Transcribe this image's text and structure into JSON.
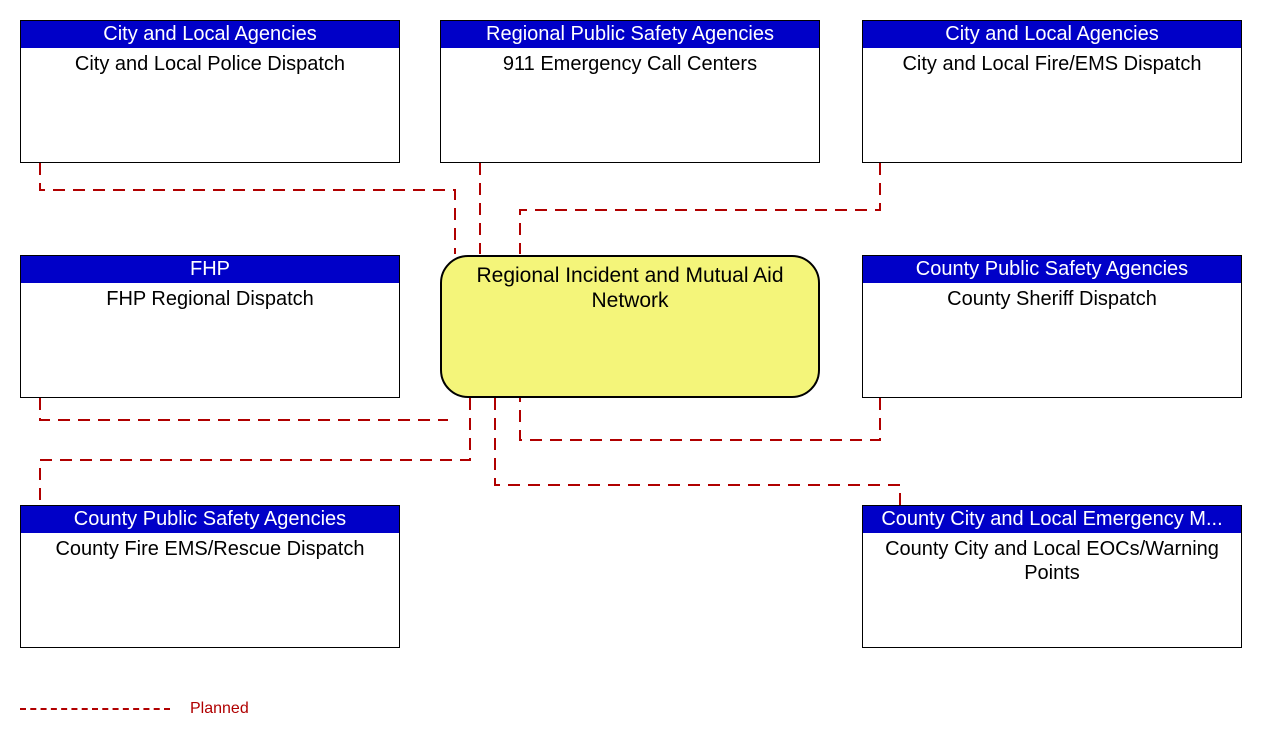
{
  "diagram": {
    "central": {
      "title": "Regional Incident and Mutual Aid Network"
    },
    "nodes": {
      "top_left": {
        "header": "City and Local Agencies",
        "body": "City and Local Police Dispatch"
      },
      "top_mid": {
        "header": "Regional Public Safety Agencies",
        "body": "911 Emergency Call Centers"
      },
      "top_right": {
        "header": "City and Local Agencies",
        "body": "City and Local Fire/EMS Dispatch"
      },
      "mid_left": {
        "header": "FHP",
        "body": "FHP Regional Dispatch"
      },
      "mid_right": {
        "header": "County Public Safety Agencies",
        "body": "County Sheriff Dispatch"
      },
      "bot_left": {
        "header": "County Public Safety Agencies",
        "body": "County Fire EMS/Rescue Dispatch"
      },
      "bot_right": {
        "header": "County City and Local Emergency M...",
        "body": "County City and Local EOCs/Warning Points"
      }
    },
    "legend": {
      "planned": "Planned"
    },
    "connections": [
      {
        "from": "top_left",
        "style": "planned"
      },
      {
        "from": "top_mid",
        "style": "planned"
      },
      {
        "from": "top_right",
        "style": "planned"
      },
      {
        "from": "mid_left",
        "style": "planned"
      },
      {
        "from": "mid_right",
        "style": "planned"
      },
      {
        "from": "bot_left",
        "style": "planned"
      },
      {
        "from": "bot_right",
        "style": "planned"
      }
    ],
    "colors": {
      "header_bg": "#0000c8",
      "central_bg": "#f4f57a",
      "line_color": "#b00000"
    }
  }
}
